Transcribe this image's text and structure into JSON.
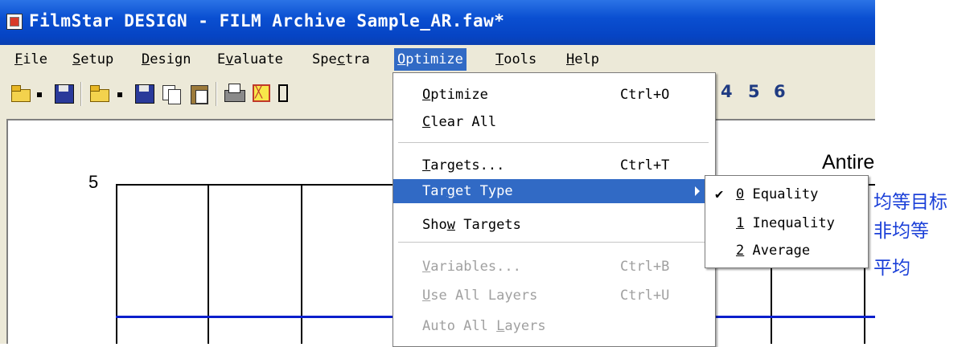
{
  "window": {
    "title": "FilmStar DESIGN - FILM Archive Sample_AR.faw*"
  },
  "menubar": [
    {
      "label": "File",
      "mnemonic": "F"
    },
    {
      "label": "Setup",
      "mnemonic": "S"
    },
    {
      "label": "Design",
      "mnemonic": "D"
    },
    {
      "label": "Evaluate",
      "mnemonic": "v"
    },
    {
      "label": "Spectra",
      "mnemonic": "c"
    },
    {
      "label": "Optimize",
      "mnemonic": "O",
      "active": true
    },
    {
      "label": "Tools",
      "mnemonic": "T"
    },
    {
      "label": "Help",
      "mnemonic": "H"
    }
  ],
  "toolbar": {
    "icons": [
      "open-icon",
      "dropdown-icon",
      "save-icon",
      "open-icon",
      "dropdown-icon",
      "save-icon",
      "copy-icon",
      "paste-icon",
      "print-icon",
      "chart-icon",
      "grid-icon"
    ],
    "numbers": [
      "4",
      "5",
      "6"
    ]
  },
  "plot": {
    "title_partial": "Antire",
    "y_tick": "5"
  },
  "optimize_menu": {
    "items": [
      {
        "label": "Optimize",
        "shortcut": "Ctrl+O",
        "enabled": true
      },
      {
        "label": "Clear All",
        "shortcut": "",
        "enabled": true
      },
      {
        "label": "Targets...",
        "shortcut": "Ctrl+T",
        "enabled": true
      },
      {
        "label": "Target Type",
        "shortcut": "",
        "enabled": true,
        "highlighted": true,
        "submenu": true
      },
      {
        "label": "Show Targets",
        "shortcut": "",
        "enabled": true
      },
      {
        "label": "Variables...",
        "shortcut": "Ctrl+B",
        "enabled": false
      },
      {
        "label": "Use All Layers",
        "shortcut": "Ctrl+U",
        "enabled": false
      },
      {
        "label": "Auto All Layers",
        "shortcut": "",
        "enabled": false
      }
    ]
  },
  "target_type_submenu": {
    "items": [
      {
        "label": "0 Equality",
        "checked": true
      },
      {
        "label": "1 Inequality",
        "checked": false
      },
      {
        "label": "2 Average",
        "checked": false
      }
    ],
    "check_glyph": "✔"
  },
  "annotations": [
    "均等目标",
    "非均等",
    "平均"
  ],
  "colors": {
    "titlebar": "#0a4fd1",
    "menu_highlight": "#316ac5",
    "plot_line": "#0a1fcc",
    "annotation_text": "#1a3fd8"
  }
}
